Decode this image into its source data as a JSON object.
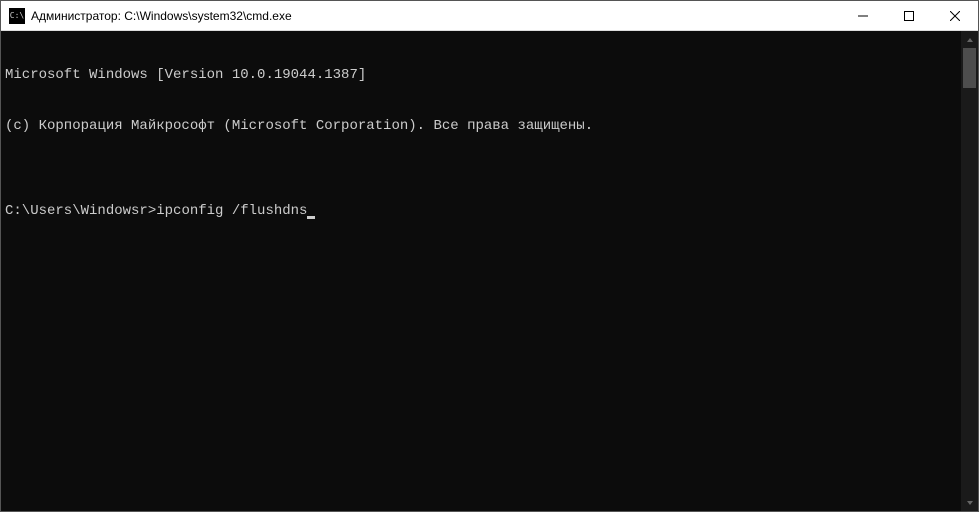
{
  "window": {
    "title": "Администратор: C:\\Windows\\system32\\cmd.exe",
    "icon_label": "C:\\"
  },
  "terminal": {
    "line1": "Microsoft Windows [Version 10.0.19044.1387]",
    "line2": "(c) Корпорация Майкрософт (Microsoft Corporation). Все права защищены.",
    "blank": "",
    "prompt": "C:\\Users\\Windowsr>",
    "command": "ipconfig /flushdns"
  }
}
